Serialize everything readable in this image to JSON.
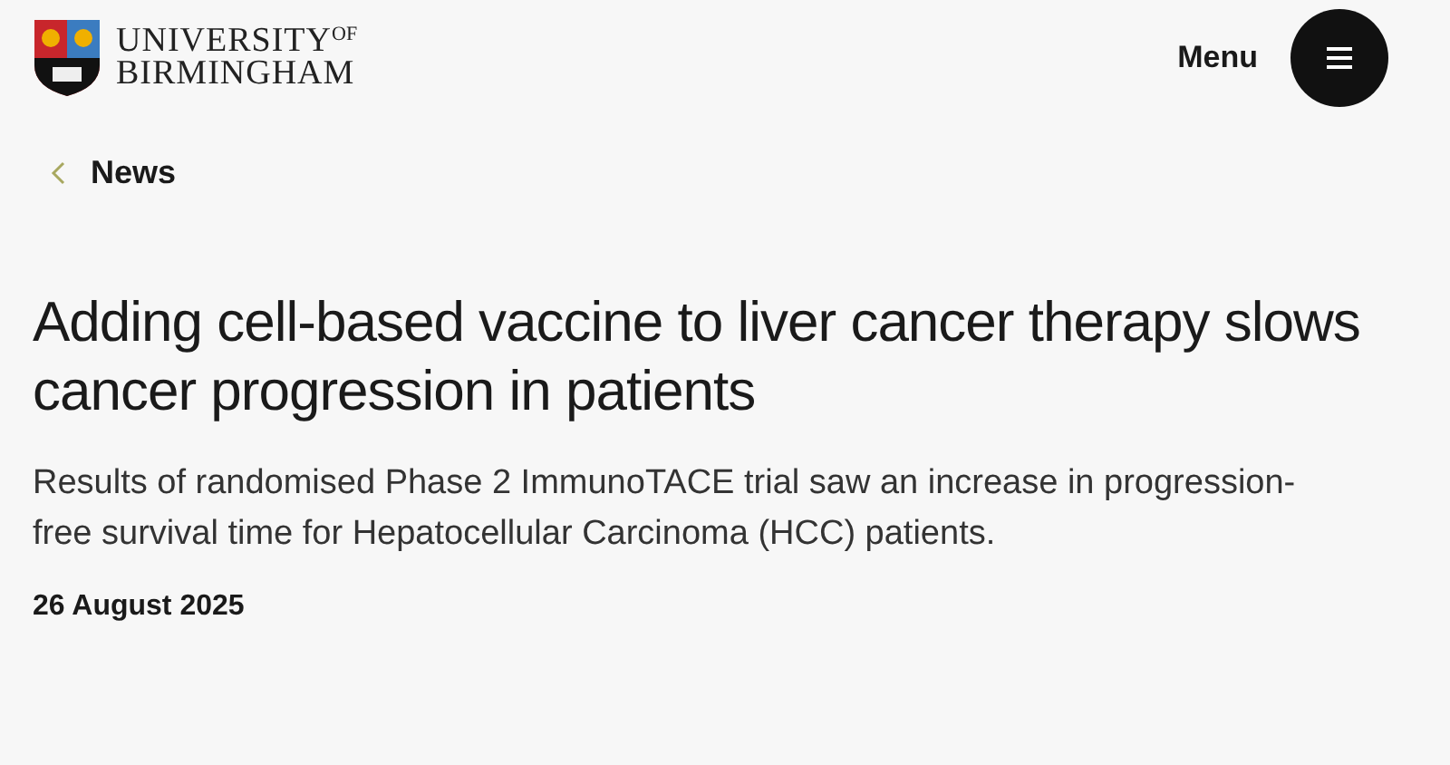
{
  "logo": {
    "line_1": "UNIVERSITY",
    "superscript": "OF",
    "line_2": "BIRMINGHAM"
  },
  "menu": {
    "label": "Menu"
  },
  "breadcrumb": {
    "label": "News"
  },
  "article": {
    "title": "Adding cell-based vaccine to liver cancer therapy slows cancer progression in patients",
    "summary": "Results of randomised Phase 2 ImmunoTACE trial saw an increase in progression-free survival time for Hepatocellular Carcinoma (HCC) patients.",
    "date": "26 August 2025"
  }
}
